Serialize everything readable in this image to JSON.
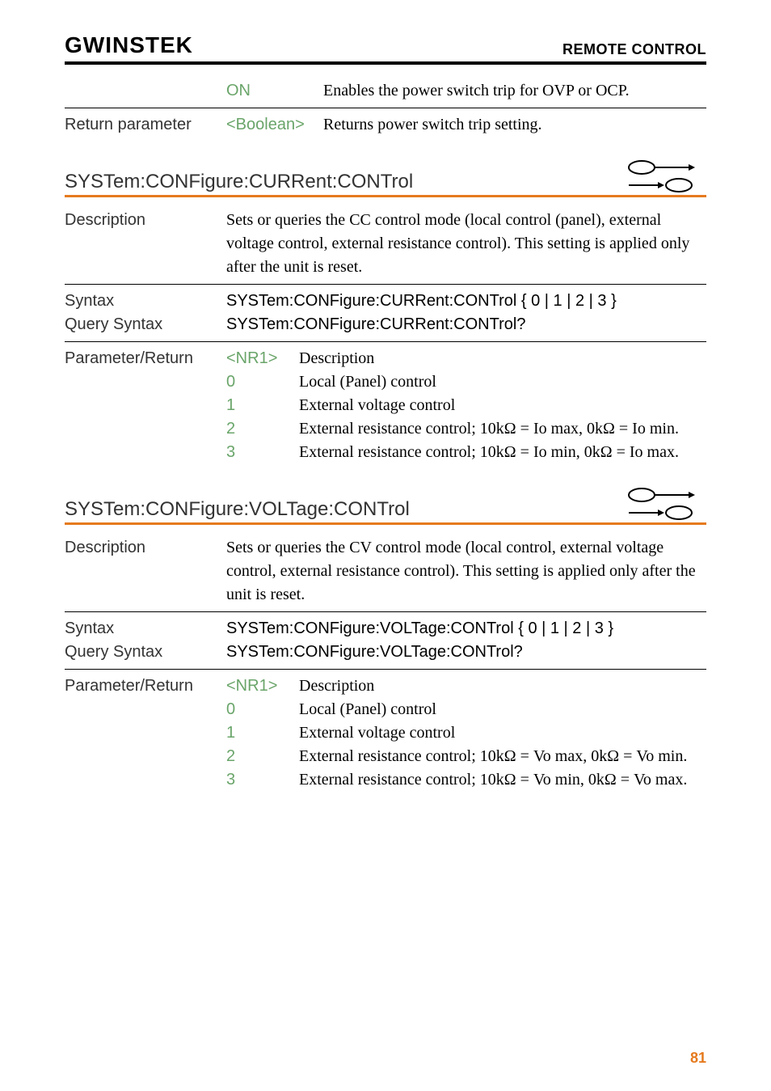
{
  "header": {
    "logo": "GWINSTEK",
    "section": "REMOTE CONTROL"
  },
  "top": {
    "param_on": "ON",
    "on_desc": "Enables the power switch trip for OVP or OCP.",
    "return_label": "Return parameter",
    "boolean": "<Boolean>",
    "return_desc": "Returns power switch trip setting."
  },
  "cmd1": {
    "title": "SYSTem:CONFigure:CURRent:CONTrol",
    "desc_label": "Description",
    "desc_text": "Sets or queries the CC control mode (local control (panel), external voltage control, external resistance control). This setting is applied only after the unit is reset.",
    "syntax_label": "Syntax",
    "syntax_text": "SYSTem:CONFigure:CURRent:CONTrol { 0 | 1 | 2 | 3 }",
    "query_label": "Query Syntax",
    "query_text": "SYSTem:CONFigure:CURRent:CONTrol?",
    "pr_label": "Parameter/Return",
    "pr_tag": "<NR1>",
    "pr_head": "Description",
    "r0_p": "0",
    "r0_d": "Local (Panel) control",
    "r1_p": "1",
    "r1_d": "External voltage control",
    "r2_p": "2",
    "r2_d": "External resistance control; 10kΩ = Io max, 0kΩ = Io min.",
    "r3_p": "3",
    "r3_d": "External resistance control; 10kΩ = Io min, 0kΩ = Io max."
  },
  "cmd2": {
    "title": "SYSTem:CONFigure:VOLTage:CONTrol",
    "desc_label": "Description",
    "desc_text": "Sets or queries the CV control mode (local control, external voltage control, external resistance control). This setting is applied only after the unit is reset.",
    "syntax_label": "Syntax",
    "syntax_text": "SYSTem:CONFigure:VOLTage:CONTrol { 0 | 1 | 2 | 3 }",
    "query_label": "Query Syntax",
    "query_text": "SYSTem:CONFigure:VOLTage:CONTrol?",
    "pr_label": "Parameter/Return",
    "pr_tag": "<NR1>",
    "pr_head": "Description",
    "r0_p": "0",
    "r0_d": "Local (Panel) control",
    "r1_p": "1",
    "r1_d": "External voltage control",
    "r2_p": "2",
    "r2_d": "External resistance control; 10kΩ = Vo max, 0kΩ = Vo min.",
    "r3_p": "3",
    "r3_d": "External resistance control; 10kΩ = Vo min, 0kΩ = Vo max."
  },
  "page": "81"
}
